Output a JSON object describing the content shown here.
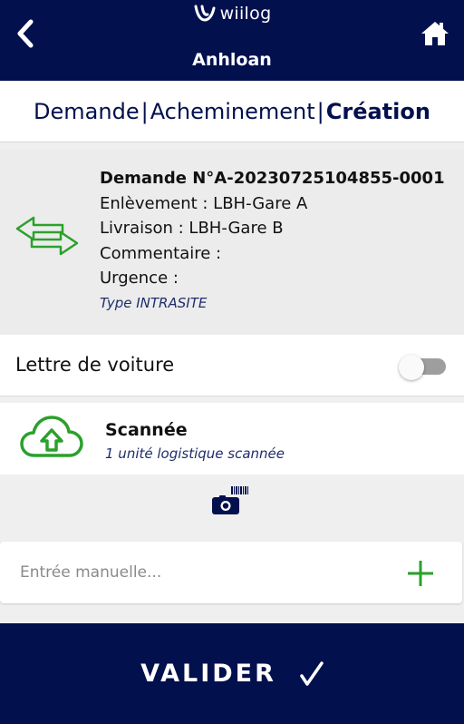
{
  "header": {
    "logo_text": "wiilog",
    "title": "Anhloan"
  },
  "steps": {
    "step1": "Demande",
    "separator": "|",
    "step2": "Acheminement",
    "step3": "Création"
  },
  "request": {
    "title": "Demande N°A-20230725104855-0001",
    "pickup": "Enlèvement : LBH-Gare A",
    "delivery": "Livraison : LBH-Gare B",
    "comment": "Commentaire :",
    "urgency": "Urgence :",
    "type": "Type INTRASITE"
  },
  "lettre": {
    "label": "Lettre de voiture",
    "enabled": false
  },
  "scan": {
    "title": "Scannée",
    "subtitle": "1 unité logistique scannée"
  },
  "manual_entry": {
    "placeholder": "Entrée manuelle...",
    "value": ""
  },
  "footer": {
    "submit_label": "VALIDER"
  },
  "icons": {
    "back": "chevron-left-icon",
    "home": "home-icon",
    "transfer": "transfer-arrows-icon",
    "cloud": "cloud-upload-icon",
    "camera": "camera-barcode-icon",
    "add": "plus-icon",
    "check": "check-icon"
  },
  "colors": {
    "navy": "#03104e",
    "green": "#2aa12a",
    "toggle_off": "#9e9e9e"
  }
}
